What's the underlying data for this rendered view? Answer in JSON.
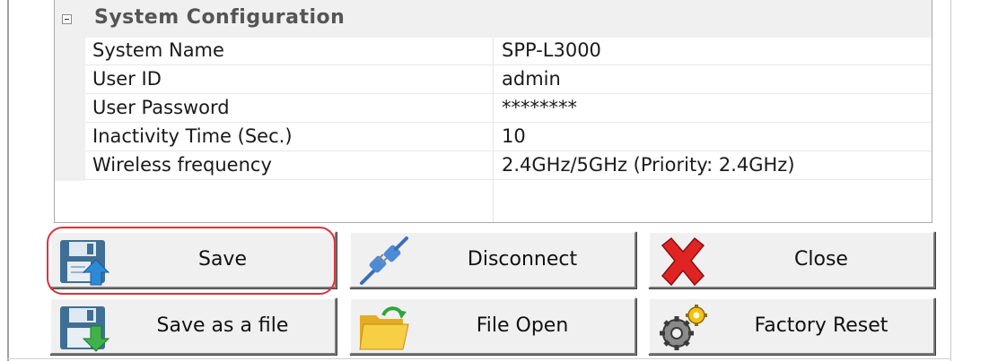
{
  "property_grid": {
    "category": "System Configuration",
    "rows": [
      {
        "name": "System Name",
        "value": "SPP-L3000"
      },
      {
        "name": "User ID",
        "value": "admin"
      },
      {
        "name": "User Password",
        "value": "********"
      },
      {
        "name": "Inactivity Time (Sec.)",
        "value": "10"
      },
      {
        "name": "Wireless frequency",
        "value": "2.4GHz/5GHz (Priority: 2.4GHz)"
      }
    ]
  },
  "buttons": {
    "save": "Save",
    "disconnect": "Disconnect",
    "close": "Close",
    "save_as_file": "Save as a file",
    "file_open": "File Open",
    "factory_reset": "Factory Reset"
  },
  "highlight_color": "#e0313c"
}
